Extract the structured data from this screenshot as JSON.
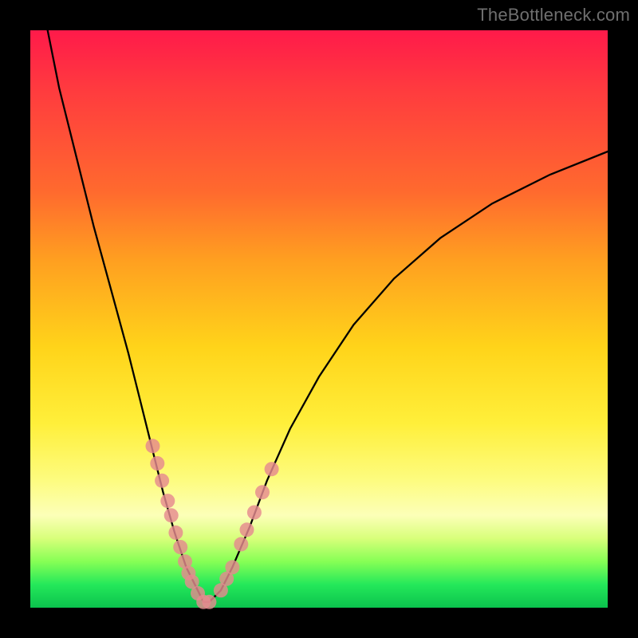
{
  "watermark": "TheBottleneck.com",
  "chart_data": {
    "type": "line",
    "title": "",
    "xlabel": "",
    "ylabel": "",
    "xlim": [
      0,
      100
    ],
    "ylim": [
      0,
      100
    ],
    "grid": false,
    "legend": false,
    "series": [
      {
        "name": "bottleneck-curve",
        "x": [
          3,
          5,
          8,
          11,
          14,
          17,
          19,
          21,
          23,
          25,
          27,
          29,
          30,
          31,
          33,
          35,
          38,
          41,
          45,
          50,
          56,
          63,
          71,
          80,
          90,
          100
        ],
        "y": [
          100,
          90,
          78,
          66,
          55,
          44,
          36,
          28,
          20,
          13,
          7,
          3,
          1,
          1,
          3,
          7,
          14,
          22,
          31,
          40,
          49,
          57,
          64,
          70,
          75,
          79
        ]
      }
    ],
    "markers": [
      {
        "name": "left-branch-dots",
        "x": [
          21.2,
          22.0,
          22.8,
          23.8,
          24.4,
          25.2,
          26.0,
          26.8,
          27.4,
          28.0,
          29.0,
          30.0,
          31.0
        ],
        "y": [
          28.0,
          25.0,
          22.0,
          18.5,
          16.0,
          13.0,
          10.5,
          8.0,
          6.0,
          4.5,
          2.5,
          1.0,
          1.0
        ]
      },
      {
        "name": "right-branch-dots",
        "x": [
          33.0,
          34.0,
          35.0,
          36.5,
          37.5,
          38.8,
          40.2,
          41.8
        ],
        "y": [
          3.0,
          5.0,
          7.0,
          11.0,
          13.5,
          16.5,
          20.0,
          24.0
        ]
      }
    ],
    "gradient_stops": [
      {
        "pos": 0,
        "color": "#ff1a4a"
      },
      {
        "pos": 10,
        "color": "#ff3a3f"
      },
      {
        "pos": 28,
        "color": "#ff6a2e"
      },
      {
        "pos": 40,
        "color": "#ffa020"
      },
      {
        "pos": 55,
        "color": "#ffd41a"
      },
      {
        "pos": 68,
        "color": "#ffef3a"
      },
      {
        "pos": 78,
        "color": "#fdfc80"
      },
      {
        "pos": 84,
        "color": "#fcffb8"
      },
      {
        "pos": 88,
        "color": "#d8ff7a"
      },
      {
        "pos": 92,
        "color": "#86ff55"
      },
      {
        "pos": 96,
        "color": "#24e85a"
      },
      {
        "pos": 100,
        "color": "#0bc24d"
      }
    ]
  }
}
